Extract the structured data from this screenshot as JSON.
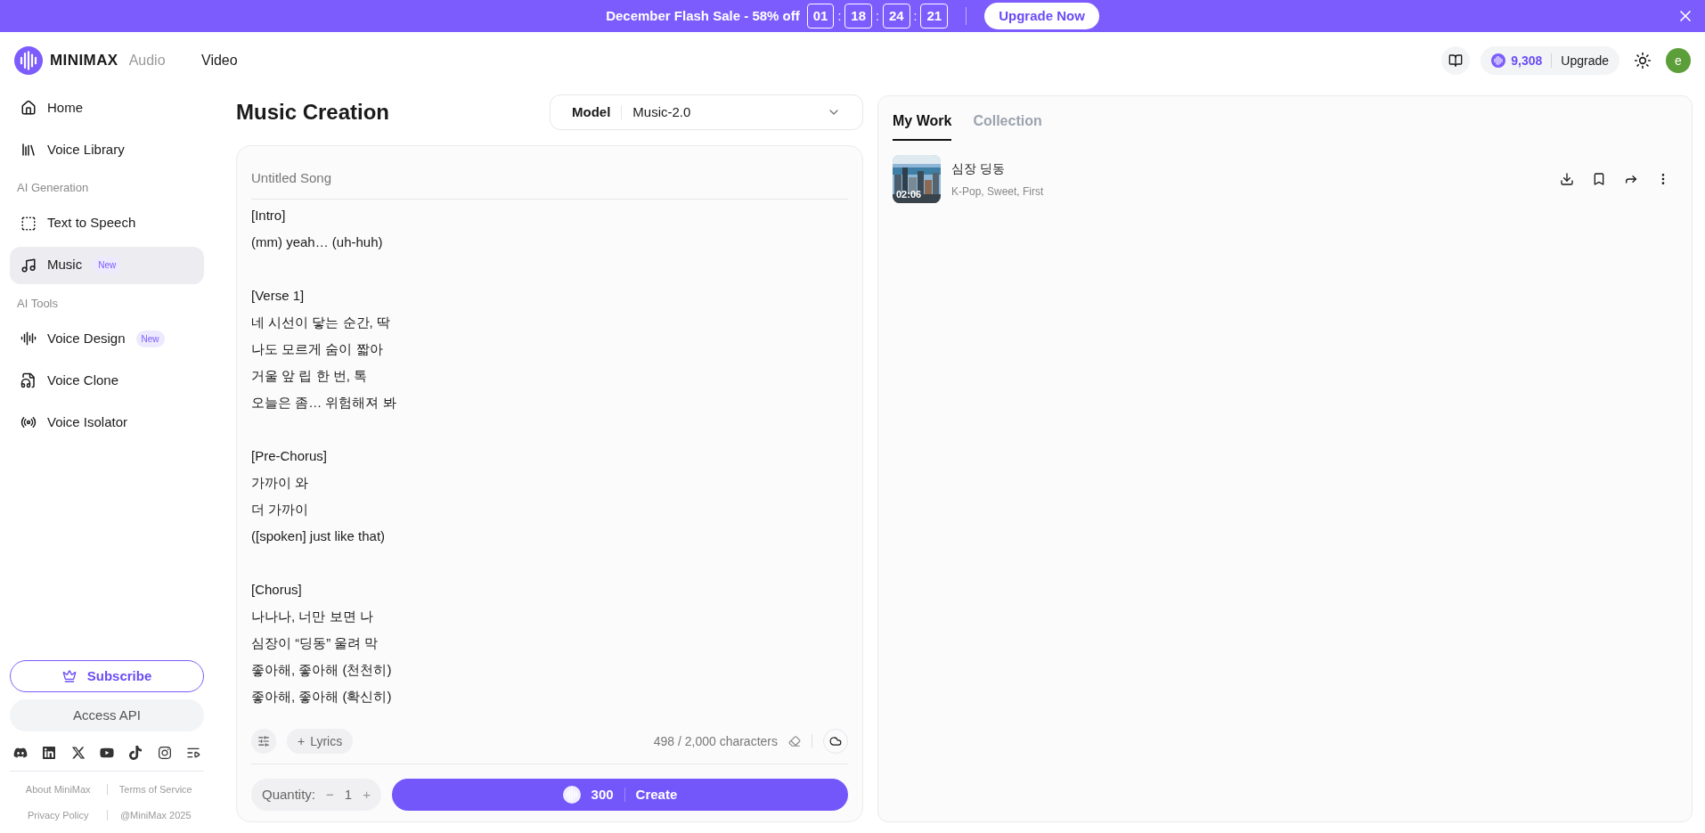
{
  "banner": {
    "text": "December Flash Sale - 58% off",
    "timer": [
      "01",
      "18",
      "24",
      "21"
    ],
    "separator": ":",
    "button": "Upgrade Now"
  },
  "header": {
    "brand": "MINIMAX",
    "nav": [
      {
        "label": "Audio",
        "selected": true
      },
      {
        "label": "Video",
        "selected": false
      }
    ],
    "credits": "9,308",
    "upgrade": "Upgrade",
    "avatar": "e"
  },
  "sidebar": {
    "groups": [
      {
        "items": [
          {
            "label": "Home",
            "selected": false
          },
          {
            "label": "Voice Library",
            "selected": false
          }
        ]
      },
      {
        "title": "AI Generation",
        "items": [
          {
            "label": "Text to Speech",
            "selected": false
          },
          {
            "label": "Music",
            "selected": true,
            "badge": "New"
          }
        ]
      },
      {
        "title": "AI Tools",
        "items": [
          {
            "label": "Voice Design",
            "selected": false,
            "badge": "New"
          },
          {
            "label": "Voice Clone",
            "selected": false
          },
          {
            "label": "Voice Isolator",
            "selected": false
          }
        ]
      }
    ],
    "subscribe": "Subscribe",
    "api": "Access API",
    "footer_links": [
      "About MiniMax",
      "Terms of Service",
      "Privacy Policy",
      "@MiniMax 2025"
    ]
  },
  "editor": {
    "title": "Music Creation",
    "model_label": "Model",
    "model": "Music-2.0",
    "song_title_placeholder": "Untitled Song",
    "lyrics": [
      {
        "lines": [
          "[Intro]",
          "(mm) yeah… (uh-huh)"
        ]
      },
      {
        "lines": [
          "[Verse 1]",
          "네 시선이 닿는 순간, 딱",
          "나도 모르게 숨이 짧아",
          "거울 앞 립 한 번, 톡",
          "오늘은 좀… 위험해져 봐"
        ]
      },
      {
        "lines": [
          "[Pre-Chorus]",
          "가까이 와",
          "더 가까이",
          "([spoken] just like that)"
        ]
      },
      {
        "lines": [
          "[Chorus]",
          "나나나, 너만 보면 나",
          "심장이 “딩동” 울려 막",
          "좋아해, 좋아해 (천천히)",
          "좋아해, 좋아해 (확신히)"
        ]
      }
    ],
    "add_lyrics": "Lyrics",
    "plus": "+",
    "char_count": "498 / 2,000 characters",
    "quantity_label": "Quantity:",
    "minus": "−",
    "quantity": "1",
    "cost": "300",
    "create": "Create"
  },
  "work": {
    "tabs": [
      {
        "label": "My Work",
        "selected": true
      },
      {
        "label": "Collection",
        "selected": false
      }
    ],
    "songs": [
      {
        "title": "심장 딩동",
        "tags": "K-Pop, Sweet, First",
        "duration": "02:06"
      }
    ]
  }
}
